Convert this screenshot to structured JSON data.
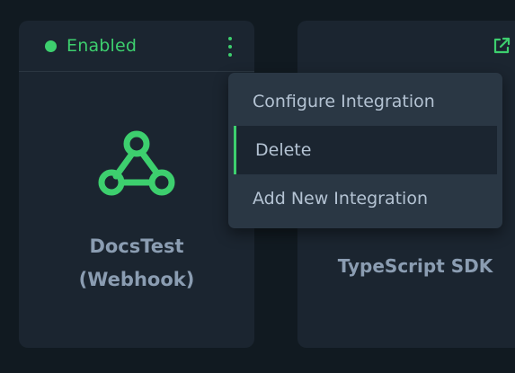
{
  "cards": [
    {
      "status": {
        "label": "Enabled",
        "color": "#3dcf6e"
      },
      "icon": "webhook-icon",
      "title_line1": "DocsTest",
      "title_line2": "(Webhook)"
    },
    {
      "icon": "external-link-icon",
      "title": "TypeScript SDK"
    }
  ],
  "menu": {
    "items": [
      {
        "label": "Configure Integration"
      },
      {
        "label": "Delete",
        "highlighted": true
      },
      {
        "label": "Add New Integration"
      }
    ]
  },
  "colors": {
    "accent": "#3dcf6e",
    "card_bg": "#1b2530",
    "page_bg": "#111a21",
    "menu_bg": "#2a3744",
    "title_text": "#8b9db2"
  }
}
